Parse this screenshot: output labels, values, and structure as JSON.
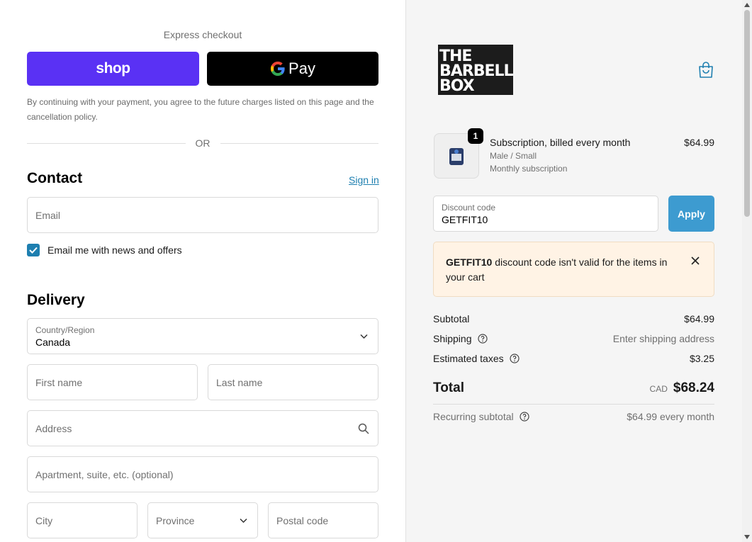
{
  "express": {
    "title": "Express checkout",
    "shop_label": "shop",
    "gpay_label": "Pay",
    "terms": "By continuing with your payment, you agree to the future charges listed on this page and the cancellation policy.",
    "or": "OR"
  },
  "contact": {
    "heading": "Contact",
    "signin": "Sign in",
    "email_placeholder": "Email",
    "newsletter_label": "Email me with news and offers",
    "newsletter_checked": true
  },
  "delivery": {
    "heading": "Delivery",
    "country_label": "Country/Region",
    "country_value": "Canada",
    "first_name": "First name",
    "last_name": "Last name",
    "address": "Address",
    "apartment": "Apartment, suite, etc. (optional)",
    "city": "City",
    "province": "Province",
    "postal": "Postal code"
  },
  "brand": {
    "logo_line1": "THE",
    "logo_line2": "BARBELL",
    "logo_line3": "BOX",
    "color": "#1c1c1c"
  },
  "cart_icon": "shopping-bag-icon",
  "item": {
    "quantity": "1",
    "name": "Subscription, billed every month",
    "variant": "Male / Small",
    "plan": "Monthly subscription",
    "price": "$64.99"
  },
  "discount": {
    "label": "Discount code",
    "value": "GETFIT10",
    "apply": "Apply",
    "error_code": "GETFIT10",
    "error_text": " discount code isn't valid for the items in your cart"
  },
  "summary": {
    "subtotal_label": "Subtotal",
    "subtotal_value": "$64.99",
    "shipping_label": "Shipping",
    "shipping_value": "Enter shipping address",
    "taxes_label": "Estimated taxes",
    "taxes_value": "$3.25",
    "total_label": "Total",
    "currency": "CAD",
    "total_value": "$68.24",
    "recurring_label": "Recurring subtotal",
    "recurring_value": "$64.99 every month"
  },
  "colors": {
    "shop_purple": "#5a31f4",
    "accent": "#1e7fb0",
    "apply_blue": "#3d9bd0",
    "alert_bg": "#fff3e5"
  }
}
